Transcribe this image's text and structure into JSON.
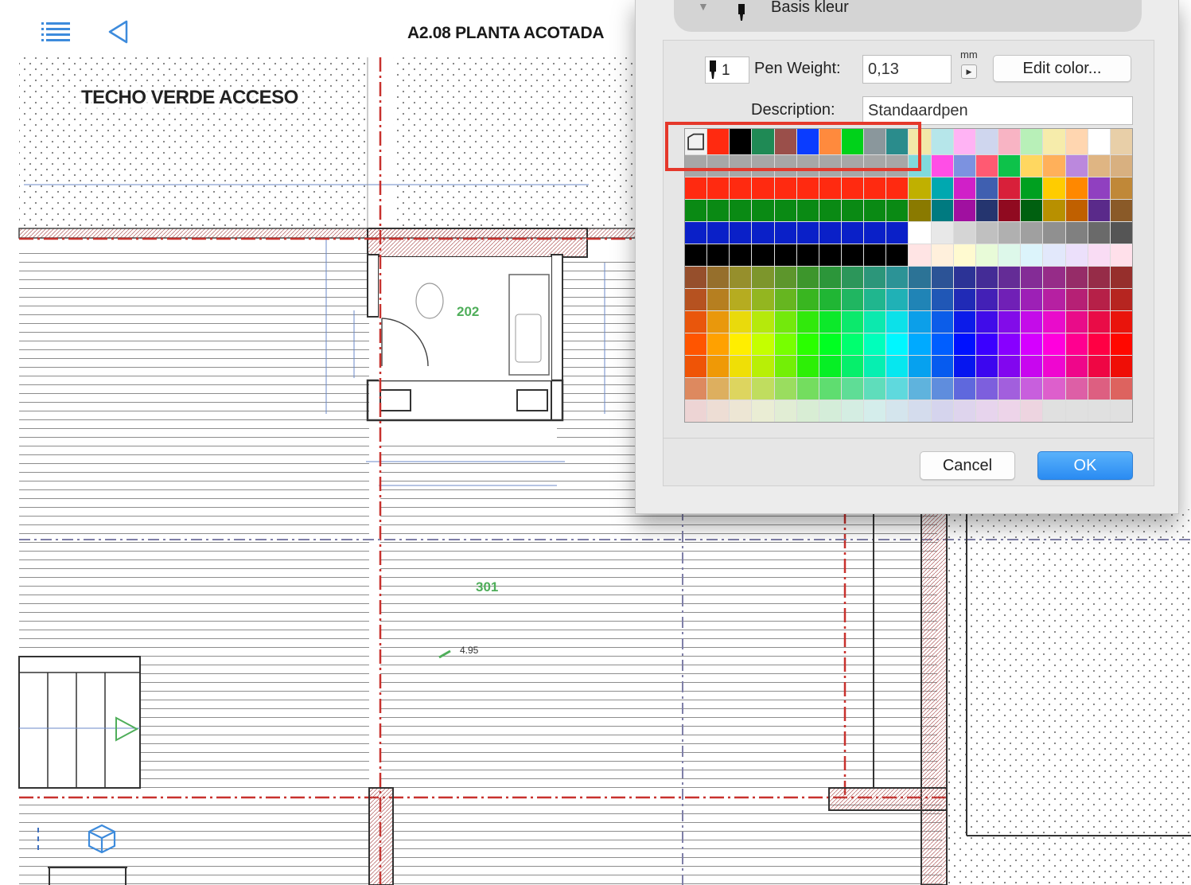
{
  "toolbar": {
    "menu_icon": "list-icon",
    "back_icon": "back-triangle-icon",
    "view3d_icon": "cube-icon",
    "sheet_title": "A2.08 PLANTA ACOTADA"
  },
  "plan": {
    "area_label": "TECHO VERDE ACCESO",
    "room_numbers": [
      "202",
      "301"
    ],
    "dimension_label": "4.95"
  },
  "dialog": {
    "header_title": "Basis kleur",
    "pen_number": "1",
    "pen_weight_label": "Pen Weight:",
    "pen_weight_value": "0,13",
    "unit": "mm",
    "unit_arrow": "▶",
    "edit_color_label": "Edit color...",
    "description_label": "Description:",
    "description_value": "Standaardpen",
    "cancel_label": "Cancel",
    "ok_label": "OK",
    "colors": {
      "accent": "#2a8bf2",
      "highlight": "#e5382b"
    }
  }
}
